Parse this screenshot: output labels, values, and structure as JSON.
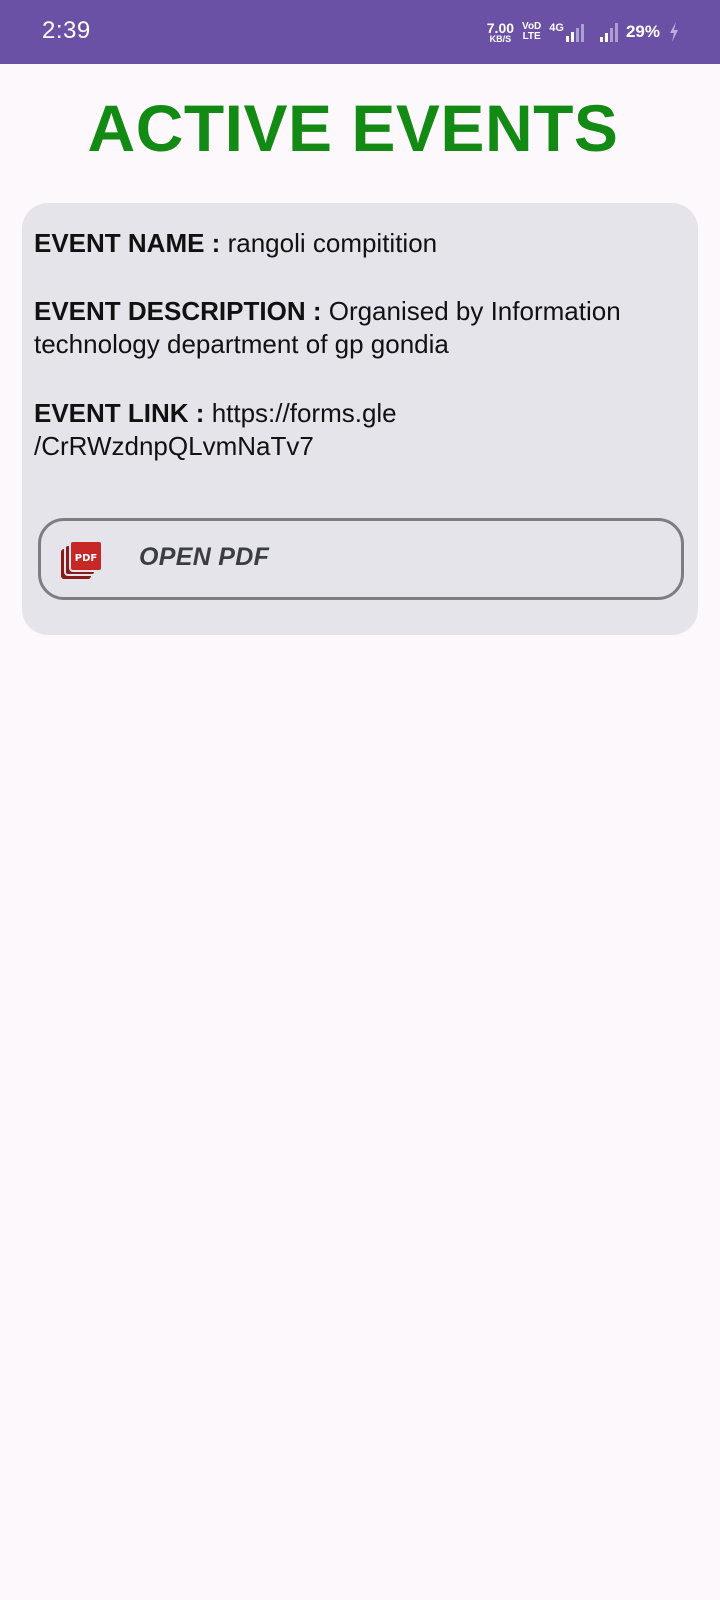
{
  "status_bar": {
    "time": "2:39",
    "net_speed_value": "7.00",
    "net_speed_unit": "KB/S",
    "volte_top": "VoD",
    "volte_bottom": "LTE",
    "network_type": "4G",
    "battery_percent": "29%",
    "icons": [
      "signal-4g-icon",
      "signal-strength-icon",
      "charging-bolt-icon"
    ]
  },
  "page": {
    "title": "ACTIVE EVENTS"
  },
  "event": {
    "name_label": "EVENT NAME :",
    "name_value": "rangoli compitition",
    "description_label": "EVENT DESCRIPTION :",
    "description_value": "Organised by Information technology department of gp gondia",
    "link_label": "EVENT LINK :",
    "link_value_line1": "https://forms.gle",
    "link_value_line2": "/CrRWzdnpQLvmNaTv7",
    "pdf_button_label": "OPEN PDF",
    "pdf_icon": "pdf-file-icon"
  },
  "colors": {
    "status_bar": "#6a51a6",
    "title": "#138a13",
    "card_background": "#e4e4ea",
    "button_border": "#7d7d82",
    "pdf_icon": "#8b1a1a",
    "page_background": "#fdf8fc"
  }
}
